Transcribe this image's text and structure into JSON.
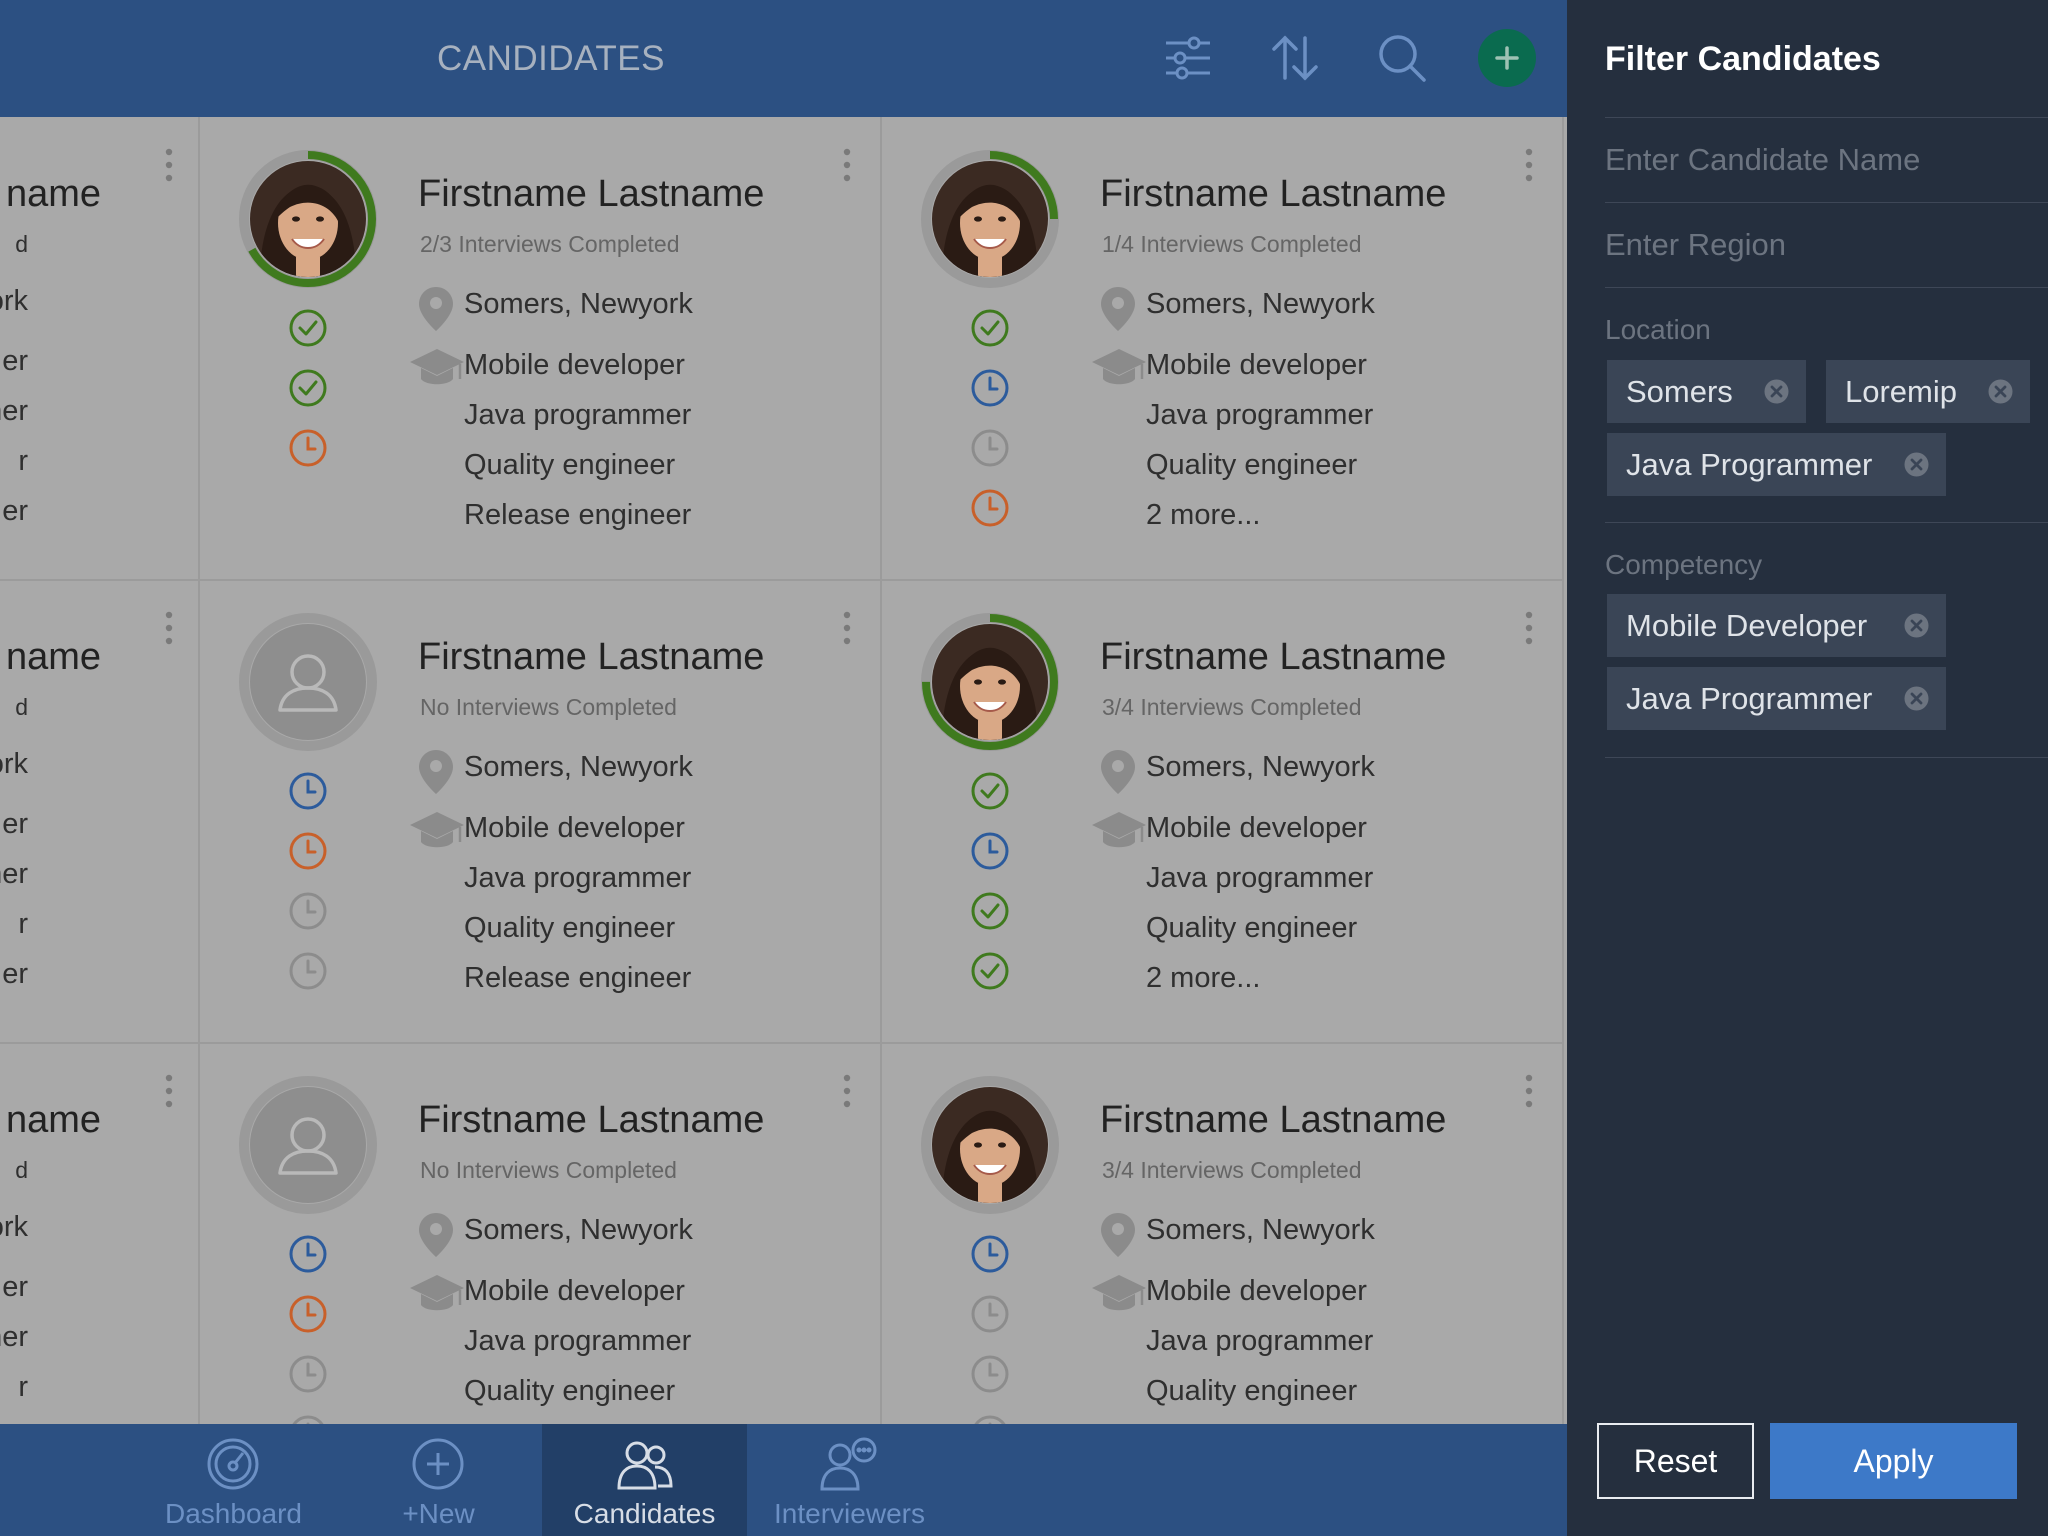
{
  "header": {
    "title": "CANDIDATES"
  },
  "icons": {
    "filter": "sliders-icon",
    "sort": "sort-arrows-icon",
    "search": "search-icon",
    "add": "plus-icon",
    "menu": "kebab-icon"
  },
  "colors": {
    "header": "#2c5082",
    "done": "#3f7a1e",
    "scheduled": "#2c5b9c",
    "pending": "#c8602a",
    "inactive": "#8c8c8c",
    "apply": "#3d79c8",
    "panel": "#252f3e"
  },
  "left_fragments": [
    {
      "name": "name",
      "rows": [
        "d",
        "ork",
        "er",
        "ner",
        "r",
        "er"
      ]
    },
    {
      "name": "name",
      "rows": [
        "d",
        "ork",
        "er",
        "ner",
        "r",
        "er"
      ]
    },
    {
      "name": "name",
      "rows": [
        "d",
        "ork",
        "er",
        "ner",
        "r"
      ]
    }
  ],
  "candidates": [
    {
      "name": "Firstname Lastname",
      "interviews": "2/3 Interviews Completed",
      "progress": 0.67,
      "photo": true,
      "location": "Somers, Newyork",
      "skills": [
        "Mobile developer",
        "Java programmer",
        "Quality engineer",
        "Release engineer"
      ],
      "statuses": [
        "done",
        "done",
        "pending"
      ]
    },
    {
      "name": "Firstname Lastname",
      "interviews": "1/4 Interviews Completed",
      "progress": 0.25,
      "photo": true,
      "location": "Somers, Newyork",
      "skills": [
        "Mobile developer",
        "Java programmer",
        "Quality engineer",
        "2 more..."
      ],
      "statuses": [
        "done",
        "scheduled",
        "inactive",
        "pending"
      ]
    },
    {
      "name": "Firstname Lastname",
      "interviews": "No Interviews Completed",
      "progress": 0,
      "photo": false,
      "location": "Somers, Newyork",
      "skills": [
        "Mobile developer",
        "Java programmer",
        "Quality engineer",
        "Release engineer"
      ],
      "statuses": [
        "scheduled",
        "pending",
        "inactive",
        "inactive"
      ]
    },
    {
      "name": "Firstname Lastname",
      "interviews": "3/4 Interviews Completed",
      "progress": 0.75,
      "photo": true,
      "location": "Somers, Newyork",
      "skills": [
        "Mobile developer",
        "Java programmer",
        "Quality engineer",
        "2 more..."
      ],
      "statuses": [
        "done",
        "scheduled",
        "done",
        "done"
      ]
    },
    {
      "name": "Firstname Lastname",
      "interviews": "No Interviews Completed",
      "progress": 0,
      "photo": false,
      "location": "Somers, Newyork",
      "skills": [
        "Mobile developer",
        "Java programmer",
        "Quality engineer"
      ],
      "statuses": [
        "scheduled",
        "pending",
        "inactive",
        "inactive"
      ]
    },
    {
      "name": "Firstname Lastname",
      "interviews": "3/4 Interviews Completed",
      "progress": 0,
      "photo": true,
      "location": "Somers, Newyork",
      "skills": [
        "Mobile developer",
        "Java programmer",
        "Quality engineer"
      ],
      "statuses": [
        "scheduled",
        "inactive",
        "inactive",
        "inactive"
      ]
    }
  ],
  "tabs": [
    {
      "label": "Dashboard",
      "icon": "gauge-icon",
      "active": false
    },
    {
      "label": "+New",
      "icon": "plus-circle-icon",
      "active": false
    },
    {
      "label": "Candidates",
      "icon": "users-icon",
      "active": true
    },
    {
      "label": "Interviewers",
      "icon": "interviewers-icon",
      "active": false
    }
  ],
  "filter": {
    "title": "Filter Candidates",
    "name_placeholder": "Enter Candidate Name",
    "region_placeholder": "Enter Region",
    "location_label": "Location",
    "location_chips": [
      "Somers",
      "Loremip",
      "Java Programmer"
    ],
    "competency_label": "Competency",
    "competency_chips": [
      "Mobile Developer",
      "Java Programmer"
    ],
    "reset_label": "Reset",
    "apply_label": "Apply"
  }
}
